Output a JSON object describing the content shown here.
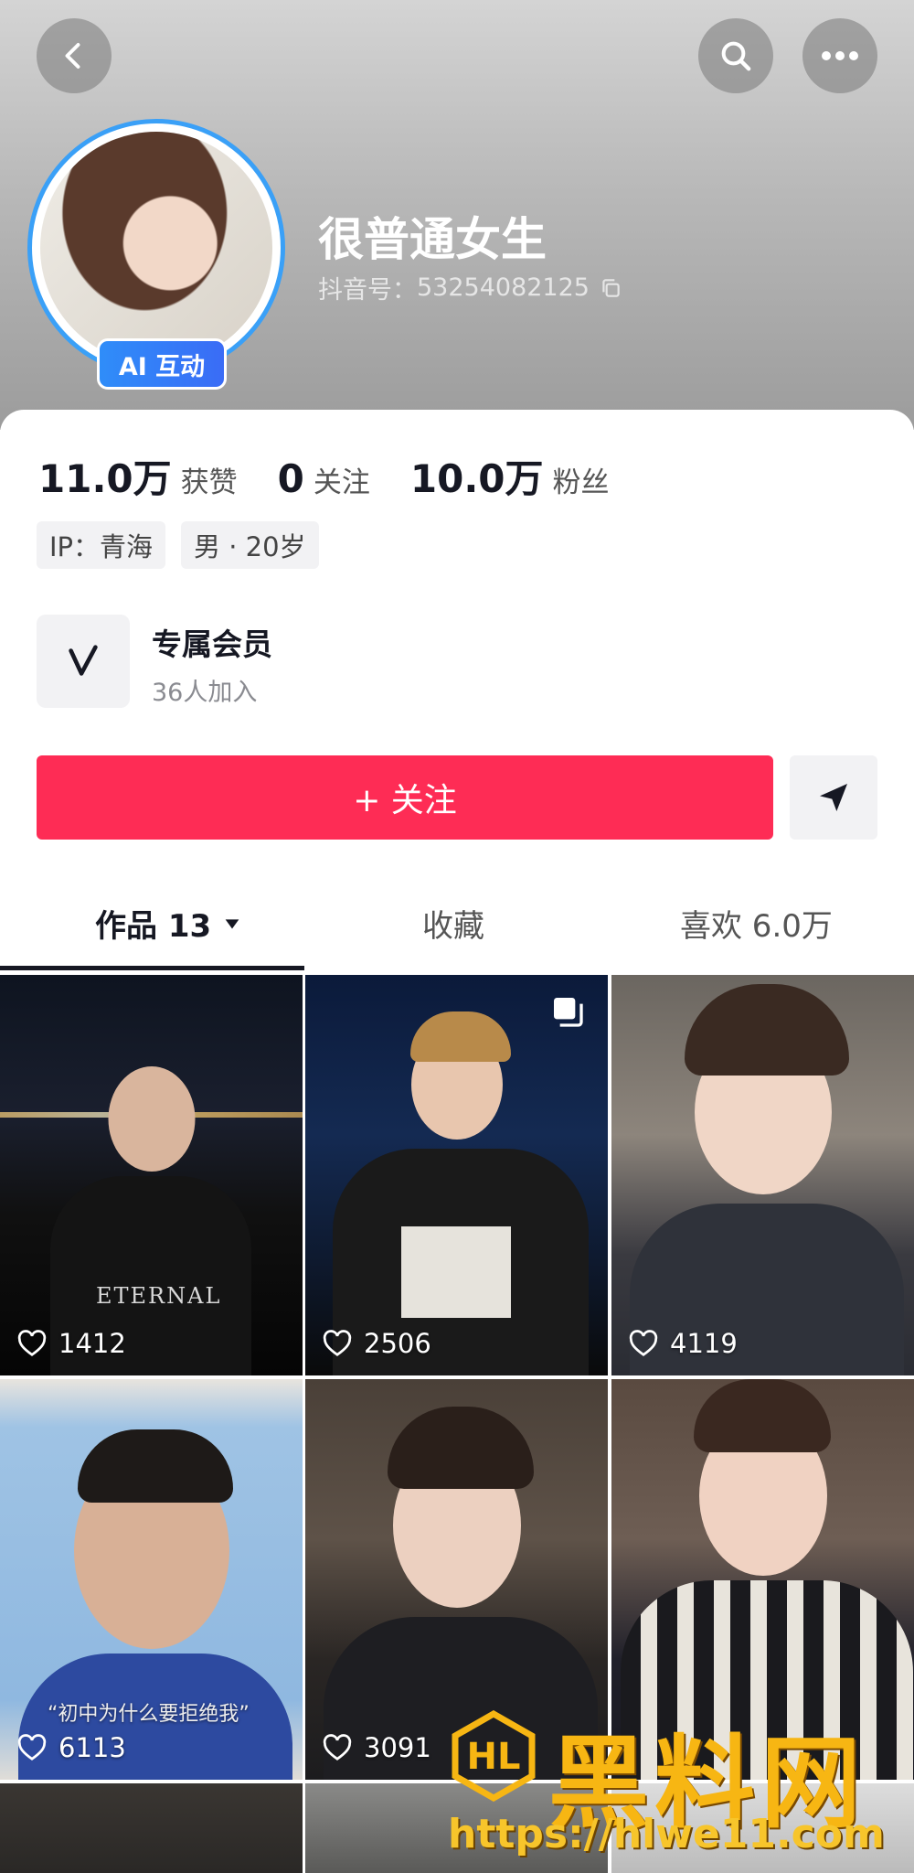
{
  "profile": {
    "name": "很普通女生",
    "account_label": "抖音号：",
    "account_id": "53254082125",
    "ai_badge": "AI 互动"
  },
  "stats": [
    {
      "value": "11.0万",
      "label": "获赞"
    },
    {
      "value": "0",
      "label": "关注"
    },
    {
      "value": "10.0万",
      "label": "粉丝"
    }
  ],
  "tags": [
    "IP：青海",
    "男 · 20岁"
  ],
  "membership": {
    "title": "专属会员",
    "subtitle": "36人加入"
  },
  "actions": {
    "follow_label": "+ 关注"
  },
  "tabs": [
    {
      "label": "作品 13"
    },
    {
      "label": "收藏"
    },
    {
      "label": "喜欢 6.0万"
    }
  ],
  "videos": [
    {
      "likes": "1412",
      "caption": "",
      "shirt_text": "ETERNAL"
    },
    {
      "likes": "2506",
      "caption": ""
    },
    {
      "likes": "4119",
      "caption": ""
    },
    {
      "likes": "6113",
      "caption": "“初中为什么要拒绝我”"
    },
    {
      "likes": "3091",
      "caption": ""
    },
    {
      "likes": "",
      "caption": ""
    }
  ],
  "watermark": {
    "brand": "黑料网",
    "url": "https://hlwe11.com"
  },
  "colors": {
    "follow": "#fe2c55",
    "ai_badge": "#2f8df9",
    "watermark": "#f7b613"
  }
}
